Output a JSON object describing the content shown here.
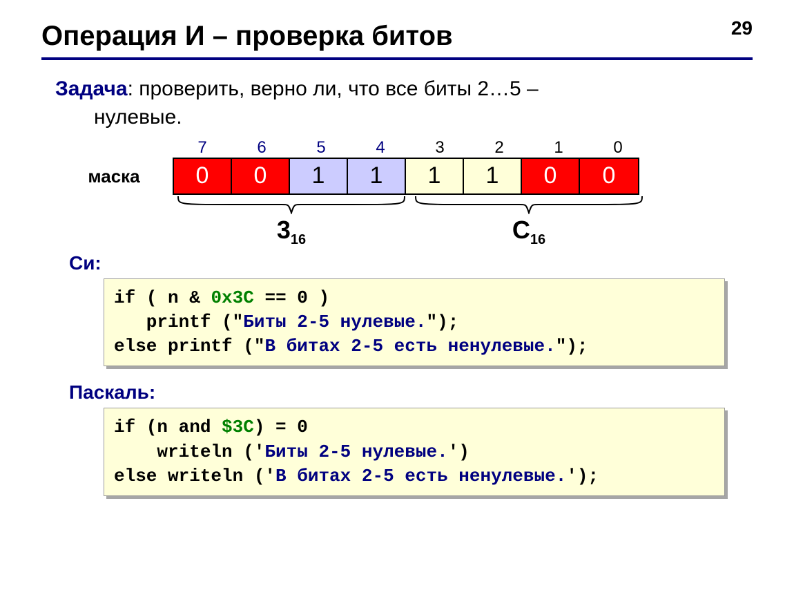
{
  "page_number": "29",
  "title": "Операция И – проверка битов",
  "task_header": "Задача",
  "task_text_line1": ": проверить, верно ли, что все биты 2…5 –",
  "task_text_line2": "нулевые.",
  "mask_label": "маска",
  "bit_indices": [
    "7",
    "6",
    "5",
    "4",
    "3",
    "2",
    "1",
    "0"
  ],
  "bit_cells": [
    "0",
    "0",
    "1",
    "1",
    "1",
    "1",
    "0",
    "0"
  ],
  "hex_left_base": "3",
  "hex_left_sub": "16",
  "hex_right_base": "C",
  "hex_right_sub": "16",
  "lang_c": "Си:",
  "lang_pascal": "Паскаль:",
  "code_c": {
    "l1a": "if ( n & ",
    "l1hex": "0x3C",
    "l1b": " == 0 )",
    "l2a": "   printf (\"",
    "l2str": "Биты 2-5 нулевые.",
    "l2b": "\");",
    "l3a": "else printf (\"",
    "l3str": "В битах 2-5 есть ненулевые.",
    "l3b": "\");"
  },
  "code_p": {
    "l1a": "if (n and ",
    "l1hex": "$3C",
    "l1b": ") = 0 ",
    "l2a": "    writeln ('",
    "l2str": "Биты 2-5 нулевые.",
    "l2b": "')",
    "l3a": "else writeln ('",
    "l3str": "В битах 2-5 есть ненулевые.",
    "l3b": "');"
  }
}
